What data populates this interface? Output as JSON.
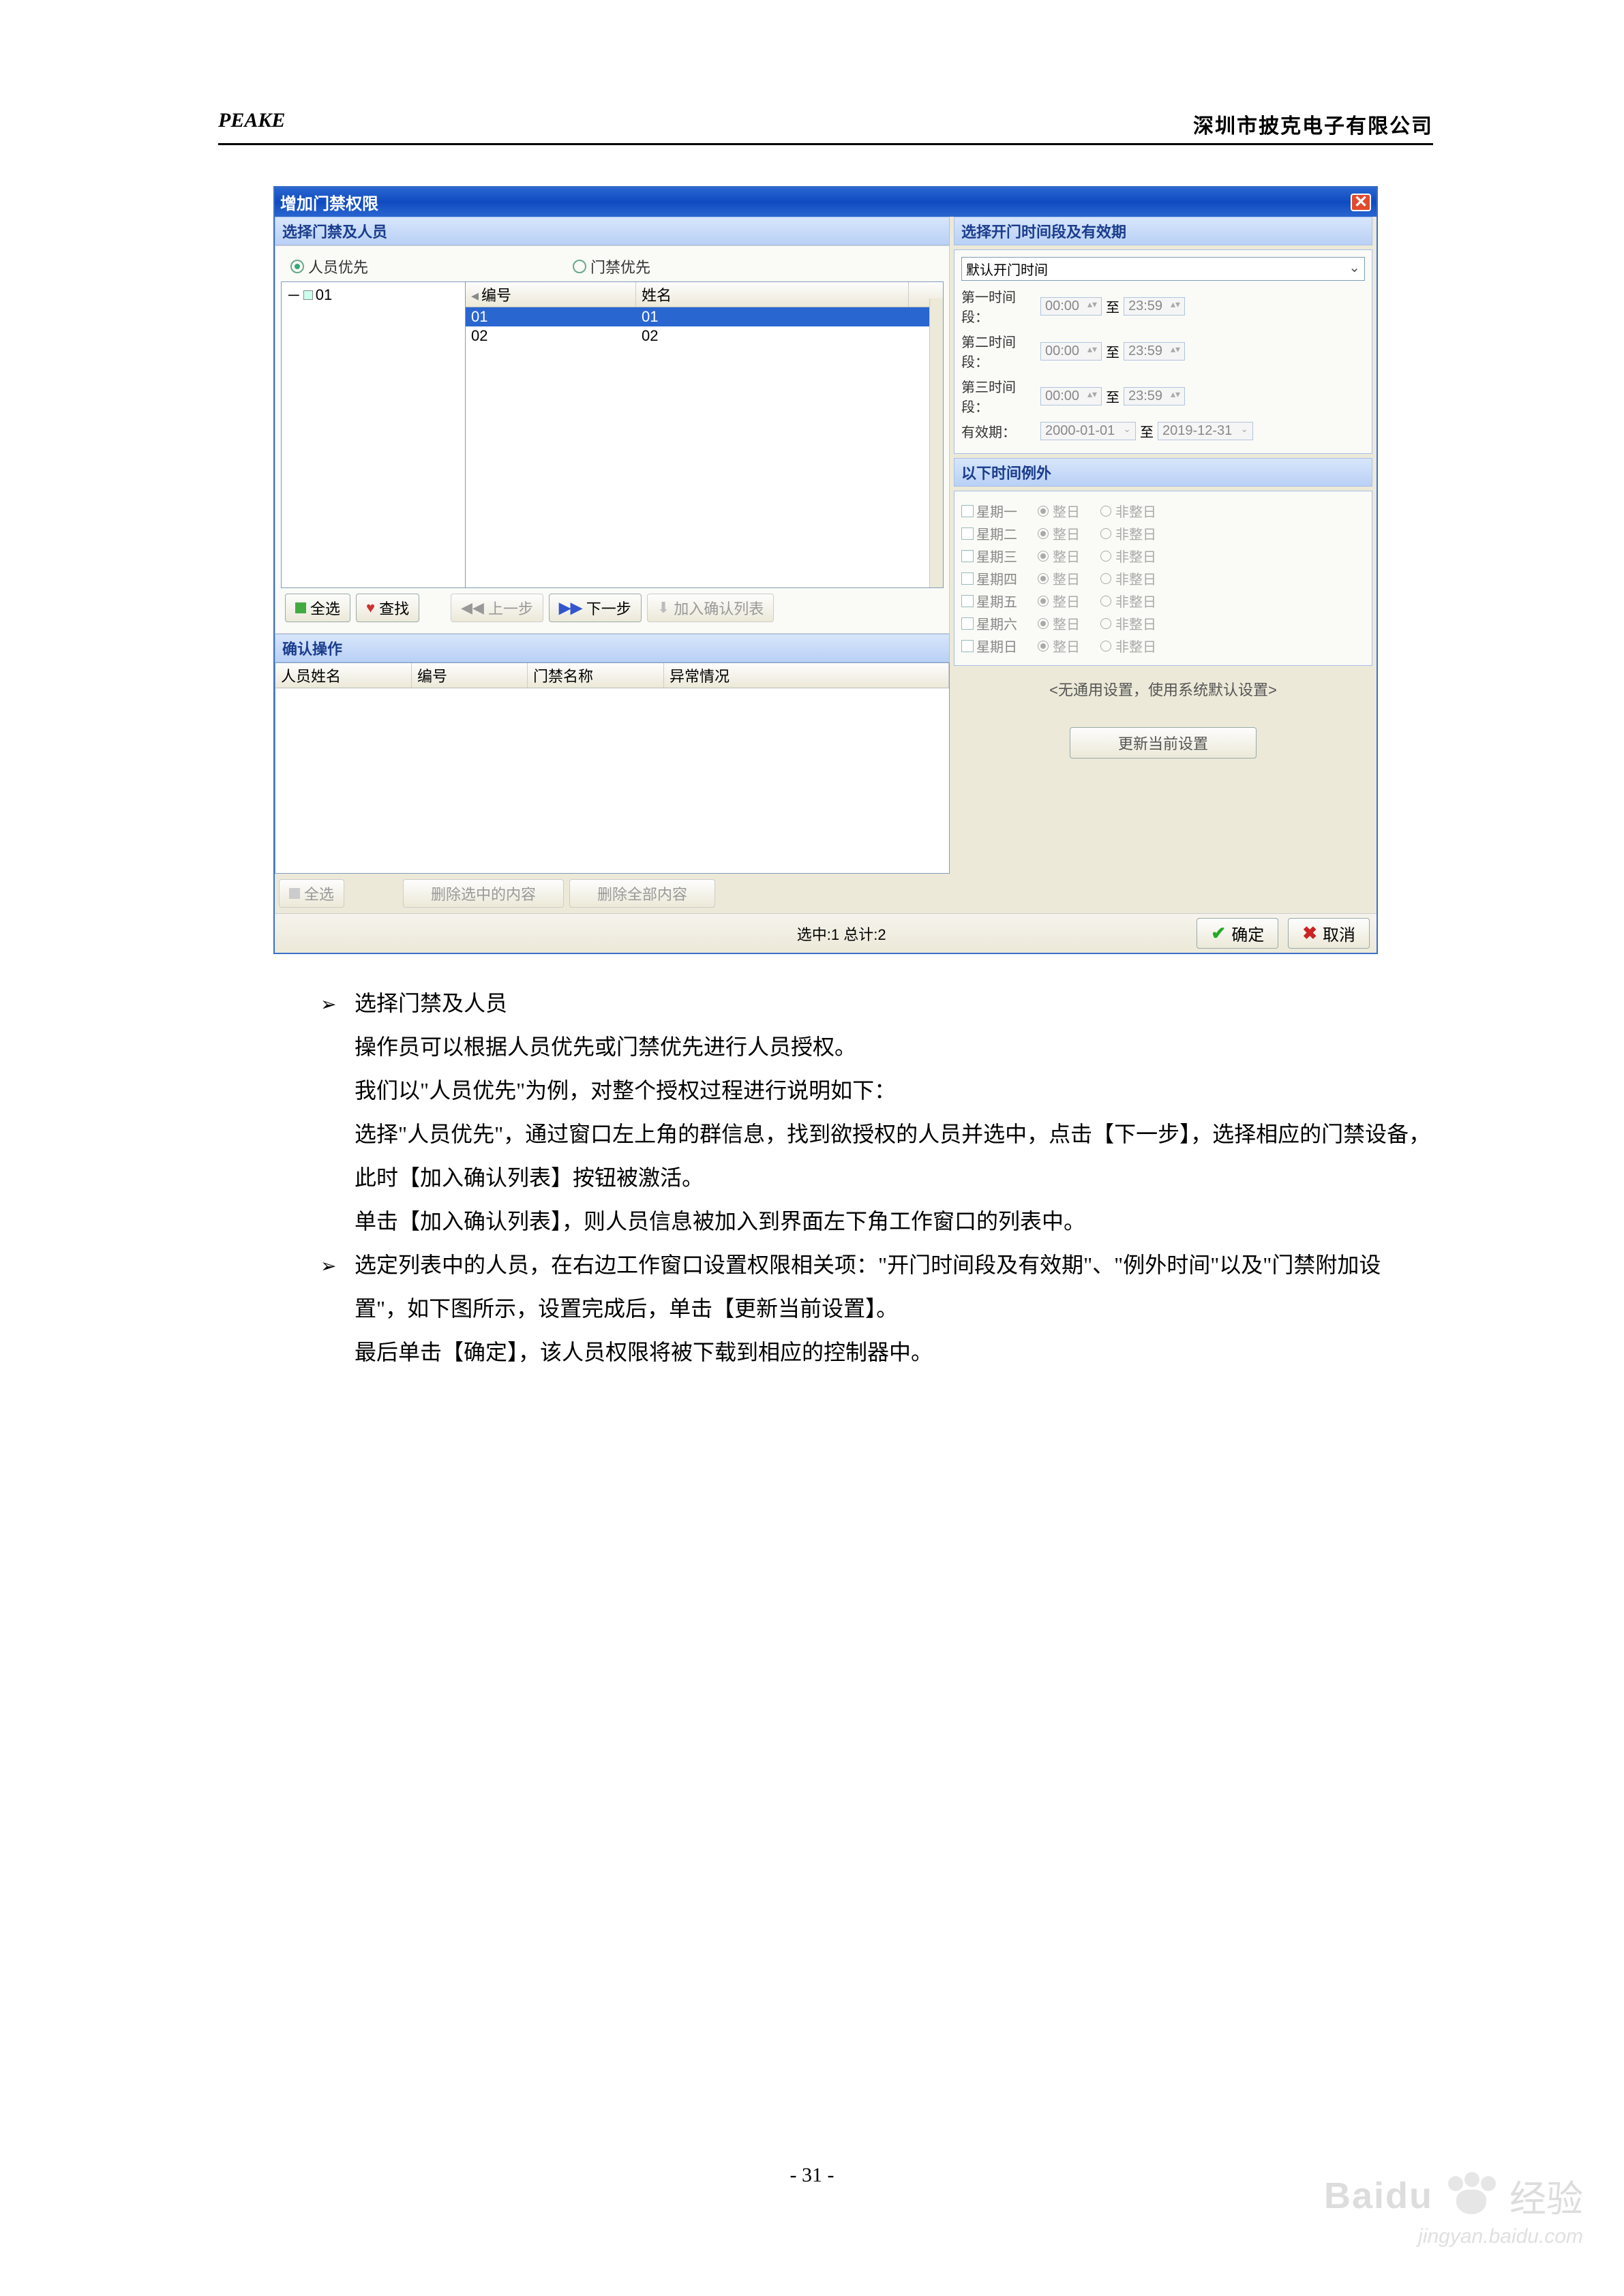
{
  "header": {
    "left": "PEAKE",
    "right": "深圳市披克电子有限公司"
  },
  "dialog": {
    "title": "增加门禁权限",
    "leftSection": "选择门禁及人员",
    "rightSection": "选择开门时间段及有效期",
    "radioPersonnel": "人员优先",
    "radioDoor": "门禁优先",
    "treeRoot": "01",
    "listCols": {
      "id": "编号",
      "name": "姓名"
    },
    "listRows": [
      {
        "id": "01",
        "name": "01"
      },
      {
        "id": "02",
        "name": "02"
      }
    ],
    "btnSelectAll": "全选",
    "btnFind": "查找",
    "btnPrev": "上一步",
    "btnNext": "下一步",
    "btnAddConfirm": "加入确认列表",
    "confirmSection": "确认操作",
    "confirmCols": {
      "name": "人员姓名",
      "id": "编号",
      "door": "门禁名称",
      "err": "异常情况"
    },
    "btnSelectAll2": "全选",
    "btnDelSel": "删除选中的内容",
    "btnDelAll": "删除全部内容",
    "openTimeSel": "默认开门时间",
    "tp1": "第一时间段：",
    "tp2": "第二时间段：",
    "tp3": "第三时间段：",
    "to": "至",
    "validLabel": "有效期：",
    "t_start": "00:00",
    "t_end": "23:59",
    "d_start": "2000-01-01",
    "d_end": "2019-12-31",
    "exceptSection": "以下时间例外",
    "days": [
      "星期一",
      "星期二",
      "星期三",
      "星期四",
      "星期五",
      "星期六",
      "星期日"
    ],
    "wholeDay": "整日",
    "notWhole": "非整日",
    "noteLine": "<无通用设置，使用系统默认设置>",
    "btnUpdate": "更新当前设置",
    "status": "选中:1 总计:2",
    "btnOk": "确定",
    "btnCancel": "取消"
  },
  "instructions": {
    "b1_title": "选择门禁及人员",
    "b1_l1": "操作员可以根据人员优先或门禁优先进行人员授权。",
    "b1_l2": "我们以\"人员优先\"为例，对整个授权过程进行说明如下：",
    "b1_l3": "选择\"人员优先\"，通过窗口左上角的群信息，找到欲授权的人员并选中，点击【下一步】，选择相应的门禁设备，此时【加入确认列表】按钮被激活。",
    "b1_l4": "单击【加入确认列表】，则人员信息被加入到界面左下角工作窗口的列表中。",
    "b2_l1": "选定列表中的人员，在右边工作窗口设置权限相关项：\"开门时间段及有效期\"、\"例外时间\"以及\"门禁附加设置\"，如下图所示，设置完成后，单击【更新当前设置】。",
    "b2_l2": "最后单击【确定】，该人员权限将被下载到相应的控制器中。"
  },
  "pageNumber": "- 31 -",
  "watermark": {
    "baidu": "Baidu",
    "jing": "经验",
    "url": "jingyan.baidu.com"
  }
}
